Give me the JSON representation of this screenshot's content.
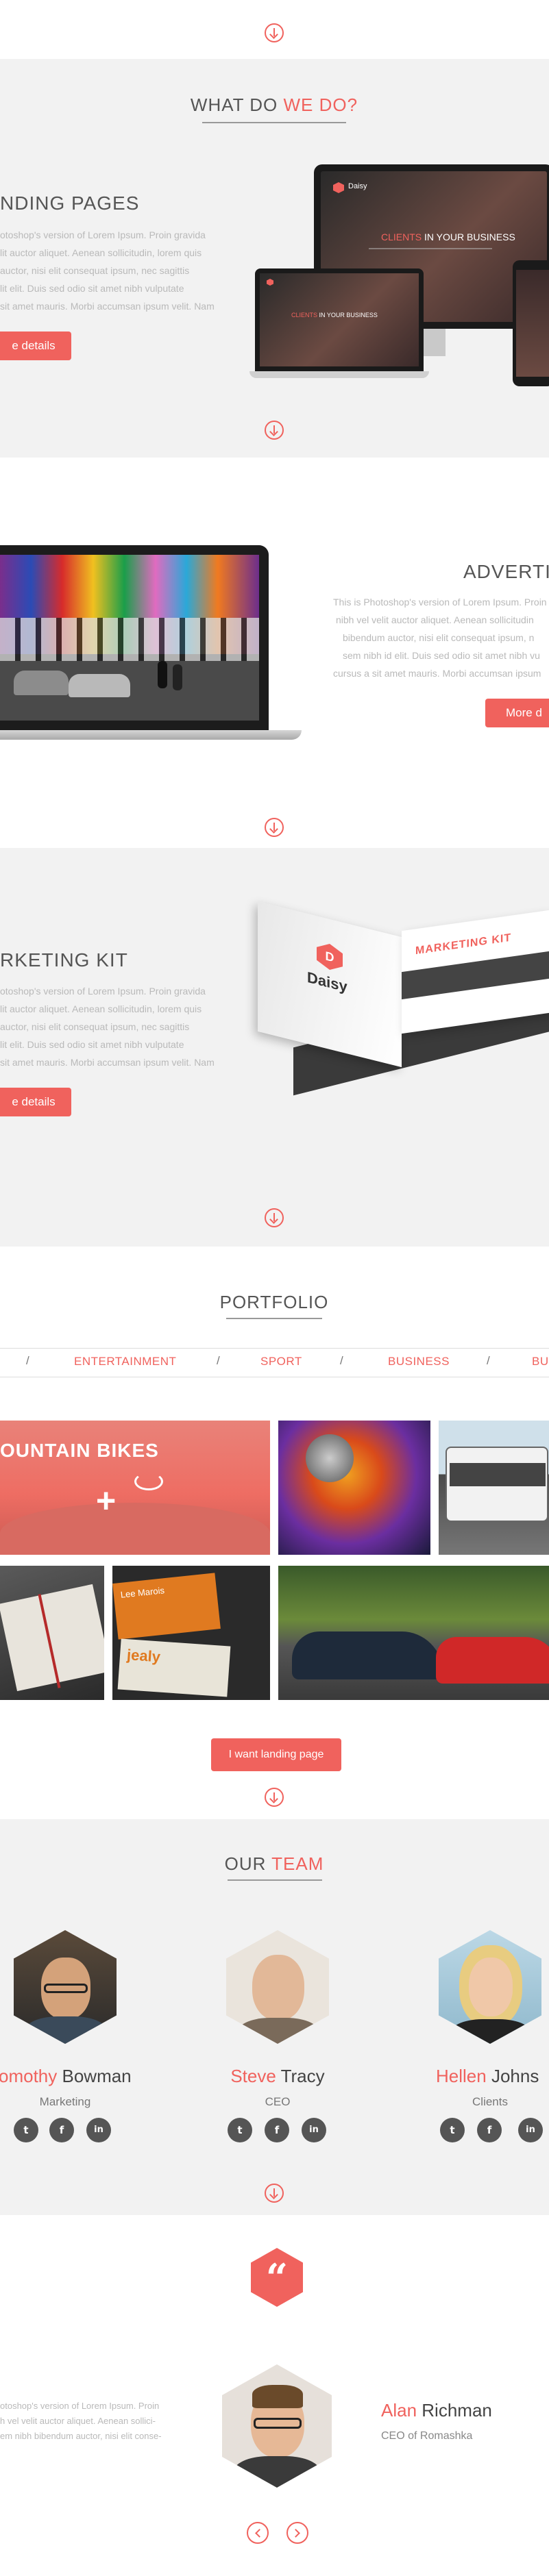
{
  "colors": {
    "accent": "#f0625d",
    "dark": "#555555",
    "light_gray": "#f2f2f2"
  },
  "icons": {
    "section_arrow": "arrow-down-circle-icon",
    "quote": "quote-icon",
    "prev": "chevron-left-icon",
    "next": "chevron-right-icon",
    "social": [
      "twitter-icon",
      "facebook-icon",
      "linkedin-icon"
    ]
  },
  "what_we_do": {
    "title_plain": "WHAT DO ",
    "title_accent": "WE DO?",
    "features": [
      {
        "title": "NDING PAGES",
        "text": [
          "otoshop's version of Lorem Ipsum. Proin gravida",
          "lit auctor aliquet. Aenean sollicitudin, lorem quis",
          "auctor, nisi elit consequat ipsum, nec sagittis",
          "lit elit. Duis sed odio sit amet nibh vulputate",
          "sit amet mauris. Morbi accumsan ipsum velit. Nam"
        ],
        "button": "e details",
        "mockup": {
          "brand": "Daisy",
          "headline_accent": "CLIENTS",
          "headline_rest": " IN YOUR BUSINESS"
        }
      },
      {
        "title": "ADVERTIS",
        "text": [
          "This is Photoshop's version of Lorem Ipsum. Proin",
          "nibh vel velit auctor aliquet. Aenean sollicitudin",
          "bibendum auctor, nisi elit consequat ipsum, n",
          "sem nibh id elit. Duis sed odio sit amet nibh vu",
          "cursus a sit amet mauris. Morbi accumsan ipsum"
        ],
        "button": "More d"
      },
      {
        "title": "RKETING KIT",
        "text": [
          "otoshop's version of Lorem Ipsum. Proin gravida",
          "lit auctor aliquet. Aenean sollicitudin, lorem quis",
          "auctor, nisi elit consequat ipsum, nec sagittis",
          "lit elit. Duis sed odio sit amet nibh vulputate",
          "sit amet mauris. Morbi accumsan ipsum velit. Nam"
        ],
        "button": "e details",
        "book": {
          "heading": "MARKETING KIT",
          "brand": "Daisy"
        }
      }
    ]
  },
  "portfolio": {
    "title": "PORTFOLIO",
    "filters": [
      "ENTERTAINMENT",
      "SPORT",
      "BUSINESS",
      "BU"
    ],
    "tiles": [
      {
        "caption": "OUNTAIN BIKES"
      }
    ],
    "cards": {
      "card1_name": "Lee Marois",
      "card2_word": "jealy"
    },
    "cta": "I want landing page"
  },
  "team": {
    "title_plain": "OUR ",
    "title_accent": "TEAM",
    "members": [
      {
        "first": "omothy",
        "last": " Bowman",
        "role": "Marketing"
      },
      {
        "first": "Steve",
        "last": " Tracy",
        "role": "CEO"
      },
      {
        "first": "Hellen",
        "last": " Johns",
        "role": "Clients"
      }
    ]
  },
  "testimonial": {
    "text": [
      "otoshop's version of Lorem Ipsum. Proin",
      "h vel velit auctor aliquet. Aenean sollici-",
      "em nibh bibendum auctor, nisi elit conse-"
    ],
    "name_first": "Alan",
    "name_last": " Richman",
    "role": "CEO of Romashka"
  }
}
